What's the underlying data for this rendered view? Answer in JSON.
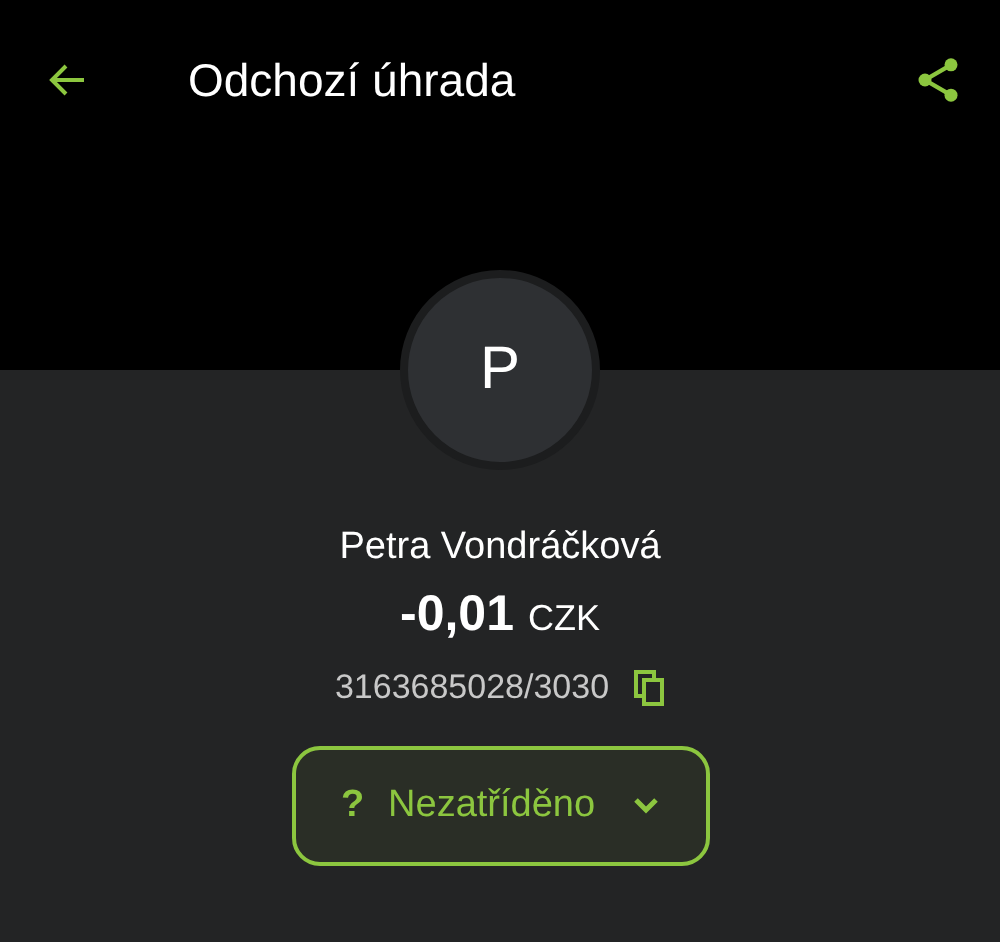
{
  "header": {
    "title": "Odchozí úhrada"
  },
  "avatar": {
    "initial": "P"
  },
  "payee": {
    "name": "Petra Vondráčková",
    "amount": "-0,01",
    "currency": "CZK",
    "account": "3163685028/3030"
  },
  "category": {
    "icon": "?",
    "label": "Nezatříděno"
  }
}
